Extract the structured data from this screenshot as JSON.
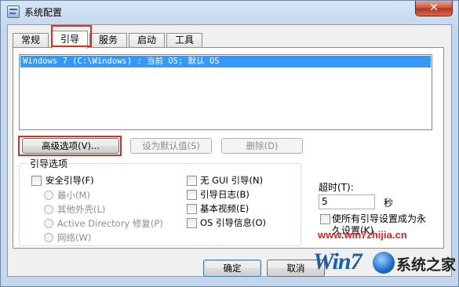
{
  "window": {
    "title": "系统配置",
    "close_glyph": "✕"
  },
  "tabs": [
    {
      "label": "常规"
    },
    {
      "label": "引导"
    },
    {
      "label": "服务"
    },
    {
      "label": "启动"
    },
    {
      "label": "工具"
    }
  ],
  "active_tab": "引导",
  "os_list": {
    "items": [
      "Windows 7 (C:\\Windows) : 当前 OS; 默认 OS"
    ],
    "selected_index": 0
  },
  "buttons": {
    "advanced": "高级选项(V)...",
    "set_default": "设为默认值(S)",
    "delete": "删除(D)"
  },
  "boot_options": {
    "title": "引导选项",
    "safe_boot": "安全引导(F)",
    "radios": [
      "最小(M)",
      "其他外壳(L)",
      "Active Directory 修复(P)",
      "网络(W)"
    ],
    "no_gui": "无 GUI 引导(N)",
    "boot_log": "引导日志(B)",
    "base_video": "基本视频(E)",
    "os_boot_info": "OS 引导信息(O)"
  },
  "timeout": {
    "label": "超时(T):",
    "value": "5",
    "unit": "秒"
  },
  "permanent_setting": "使所有引导设置成为永久设置(K)",
  "footer": {
    "ok": "确定",
    "cancel": "取消"
  },
  "watermark": {
    "url": "www.win7zhijia.cn",
    "logo_text": "系统之家"
  },
  "colors": {
    "selection": "#3399ff",
    "highlight_box": "#e02b25",
    "watermark_url": "#e52020"
  }
}
